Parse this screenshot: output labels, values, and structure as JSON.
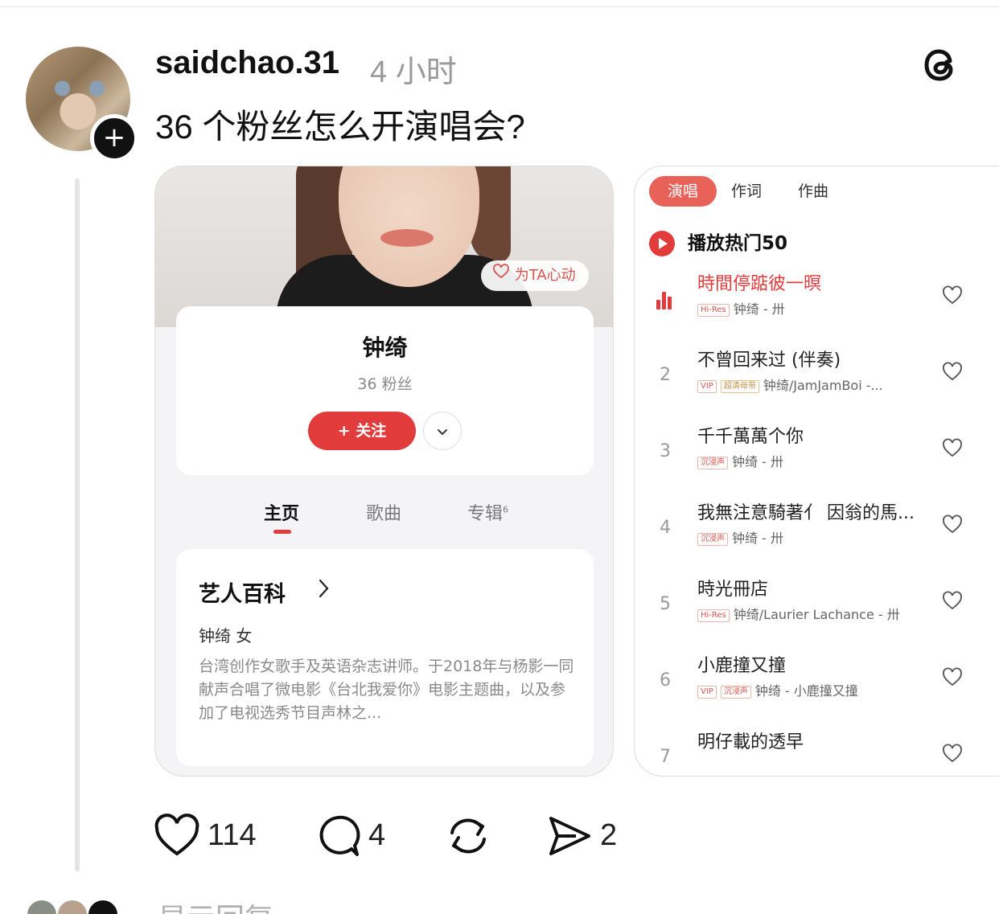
{
  "post": {
    "username": "saidchao.31",
    "time": "4 小时",
    "text": "36 个粉丝怎么开演唱会?"
  },
  "left_card": {
    "heart_pill": "为TA心动",
    "artist_name": "钟绮",
    "fans": "36 粉丝",
    "follow_button": "+ 关注",
    "tabs": [
      {
        "label": "主页"
      },
      {
        "label": "歌曲"
      },
      {
        "label": "专辑",
        "count": "6"
      }
    ],
    "wiki": {
      "title": "艺人百科",
      "meta": "钟绮  女",
      "description": "台湾创作女歌手及英语杂志讲师。于2018年与杨影一同献声合唱了微电影《台北我爱你》电影主题曲，以及参加了电视选秀节目声林之..."
    }
  },
  "right_card": {
    "sub_tabs": [
      "演唱",
      "作词",
      "作曲"
    ],
    "hot_label": "播放热门50",
    "songs": [
      {
        "rank": "",
        "playing": true,
        "title": "時間停踮彼一暝",
        "badges": [
          "Hi-Res"
        ],
        "meta": "钟绮 - 卅"
      },
      {
        "rank": "2",
        "title": "不曾回来过 (伴奏)",
        "badges": [
          "VIP",
          "超清母带"
        ],
        "meta": "钟绮/JamJamBoi -..."
      },
      {
        "rank": "3",
        "title": "千千萬萬个你",
        "badges": [
          "沉浸声"
        ],
        "meta": "钟绮 - 卅"
      },
      {
        "rank": "4",
        "title": "我無注意騎著亻 因翁的馬...",
        "badges": [
          "沉浸声"
        ],
        "meta": "钟绮 - 卅"
      },
      {
        "rank": "5",
        "title": "時光冊店",
        "badges": [
          "Hi-Res"
        ],
        "meta": "钟绮/Laurier Lachance - 卅"
      },
      {
        "rank": "6",
        "title": "小鹿撞又撞",
        "badges": [
          "VIP",
          "沉浸声"
        ],
        "meta": "钟绮 - 小鹿撞又撞"
      },
      {
        "rank": "7",
        "title": "明仔載的透早",
        "badges": [],
        "meta": ""
      }
    ]
  },
  "actions": {
    "likes": "114",
    "comments": "4",
    "shares": "2"
  },
  "reply_row": {
    "text": "显示回复"
  },
  "icons": {
    "threads": "threads-logo-icon",
    "like": "heart-icon",
    "comment": "comment-icon",
    "repost": "repost-icon",
    "share": "send-icon"
  },
  "colors": {
    "accent_red": "#e23b3b",
    "muted_text": "#9a9a9a"
  }
}
